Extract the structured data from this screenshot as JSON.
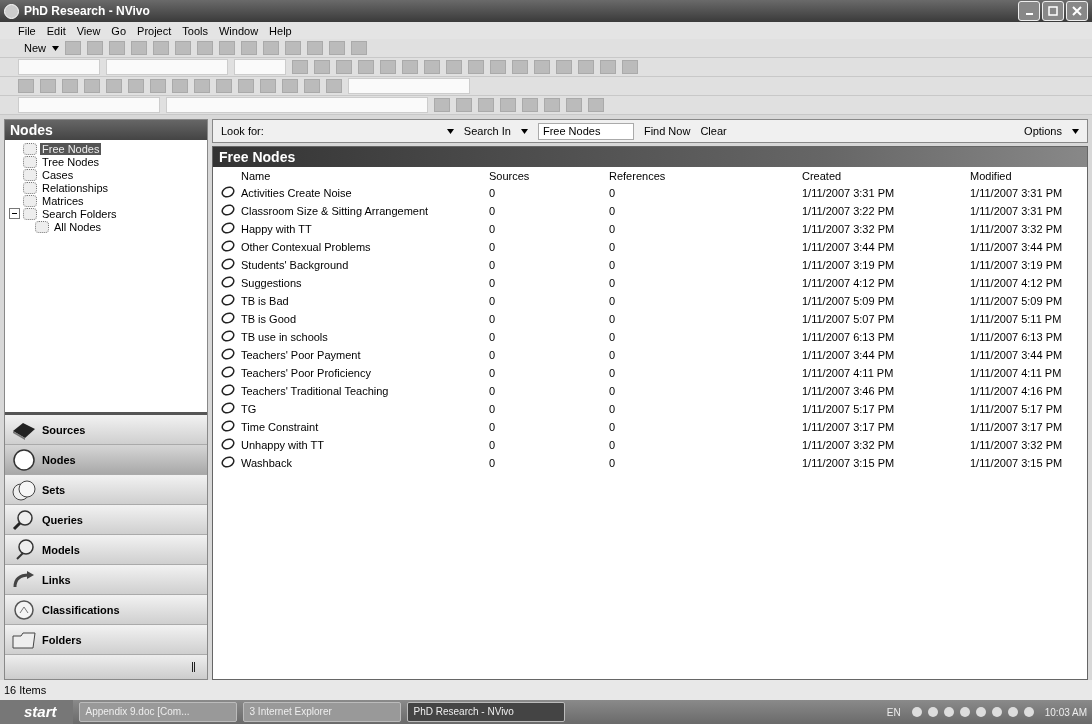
{
  "window": {
    "title": "PhD Research - NVivo"
  },
  "menu": [
    "File",
    "Edit",
    "View",
    "Go",
    "Project",
    "Tools",
    "Window",
    "Help"
  ],
  "toolbar": {
    "new_button": "New"
  },
  "sidebar": {
    "title": "Nodes",
    "tree": [
      {
        "label": "Free Nodes",
        "selected": true
      },
      {
        "label": "Tree Nodes",
        "selected": false
      },
      {
        "label": "Cases",
        "selected": false
      },
      {
        "label": "Relationships",
        "selected": false
      },
      {
        "label": "Matrices",
        "selected": false
      },
      {
        "label": "Search Folders",
        "selected": false,
        "expanded": true,
        "children": [
          {
            "label": "All Nodes",
            "selected": false
          }
        ]
      }
    ],
    "nav": [
      {
        "label": "Sources",
        "kind": "sources",
        "selected": false
      },
      {
        "label": "Nodes",
        "kind": "nodes",
        "selected": true
      },
      {
        "label": "Sets",
        "kind": "sets",
        "selected": false
      },
      {
        "label": "Queries",
        "kind": "queries",
        "selected": false
      },
      {
        "label": "Models",
        "kind": "models",
        "selected": false
      },
      {
        "label": "Links",
        "kind": "links",
        "selected": false
      },
      {
        "label": "Classifications",
        "kind": "classifications",
        "selected": false
      },
      {
        "label": "Folders",
        "kind": "folders",
        "selected": false
      }
    ]
  },
  "find_bar": {
    "look_for": "Look for:",
    "search_in": "Search In",
    "search_in_value": "Free Nodes",
    "find_now": "Find Now",
    "clear": "Clear",
    "options": "Options"
  },
  "list": {
    "title": "Free Nodes",
    "columns": [
      "Name",
      "Sources",
      "References",
      "Created",
      "Modified"
    ],
    "rows": [
      [
        "Activities Create Noise",
        "0",
        "0",
        "1/11/2007 3:31 PM",
        "1/11/2007 3:31 PM"
      ],
      [
        "Classroom Size & Sitting Arrangement",
        "0",
        "0",
        "1/11/2007 3:22 PM",
        "1/11/2007 3:31 PM"
      ],
      [
        "Happy with TT",
        "0",
        "0",
        "1/11/2007 3:32 PM",
        "1/11/2007 3:32 PM"
      ],
      [
        "Other Contexual Problems",
        "0",
        "0",
        "1/11/2007 3:44 PM",
        "1/11/2007 3:44 PM"
      ],
      [
        "Students' Background",
        "0",
        "0",
        "1/11/2007 3:19 PM",
        "1/11/2007 3:19 PM"
      ],
      [
        "Suggestions",
        "0",
        "0",
        "1/11/2007 4:12 PM",
        "1/11/2007 4:12 PM"
      ],
      [
        "TB is Bad",
        "0",
        "0",
        "1/11/2007 5:09 PM",
        "1/11/2007 5:09 PM"
      ],
      [
        "TB is Good",
        "0",
        "0",
        "1/11/2007 5:07 PM",
        "1/11/2007 5:11 PM"
      ],
      [
        "TB use in schools",
        "0",
        "0",
        "1/11/2007 6:13 PM",
        "1/11/2007 6:13 PM"
      ],
      [
        "Teachers' Poor Payment",
        "0",
        "0",
        "1/11/2007 3:44 PM",
        "1/11/2007 3:44 PM"
      ],
      [
        "Teachers' Poor Proficiency",
        "0",
        "0",
        "1/11/2007 4:11 PM",
        "1/11/2007 4:11 PM"
      ],
      [
        "Teachers' Traditional Teaching",
        "0",
        "0",
        "1/11/2007 3:46 PM",
        "1/11/2007 4:16 PM"
      ],
      [
        "TG",
        "0",
        "0",
        "1/11/2007 5:17 PM",
        "1/11/2007 5:17 PM"
      ],
      [
        "Time Constraint",
        "0",
        "0",
        "1/11/2007 3:17 PM",
        "1/11/2007 3:17 PM"
      ],
      [
        "Unhappy with TT",
        "0",
        "0",
        "1/11/2007 3:32 PM",
        "1/11/2007 3:32 PM"
      ],
      [
        "Washback",
        "0",
        "0",
        "1/11/2007 3:15 PM",
        "1/11/2007 3:15 PM"
      ]
    ]
  },
  "status_bar": "16 Items",
  "taskbar": {
    "start": "start",
    "tasks": [
      {
        "label": "Appendix 9.doc [Com...",
        "selected": false
      },
      {
        "label": "3 Internet Explorer",
        "selected": false
      },
      {
        "label": "PhD Research - NVivo",
        "selected": true
      }
    ],
    "language": "EN",
    "clock": "10:03 AM"
  }
}
